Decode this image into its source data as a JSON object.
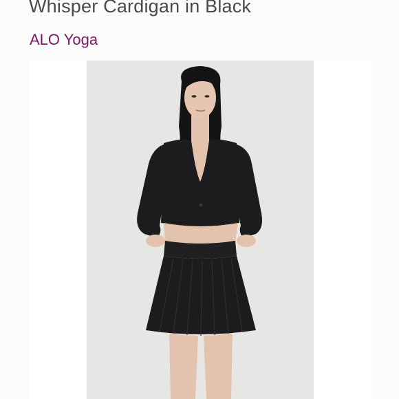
{
  "product": {
    "title": "Whisper Cardigan in Black",
    "brand": "ALO Yoga"
  },
  "photo": {
    "subject": "model wearing cropped black ribbed cardigan and black pleated mini skirt",
    "background_color": "#e6e6e4",
    "garment_color": "#1c1c1e",
    "skin_color": "#e3c3ad"
  },
  "colors": {
    "title_text": "#4a4a4a",
    "brand_link": "#7b1766",
    "page_background": "#fcfcfc"
  }
}
